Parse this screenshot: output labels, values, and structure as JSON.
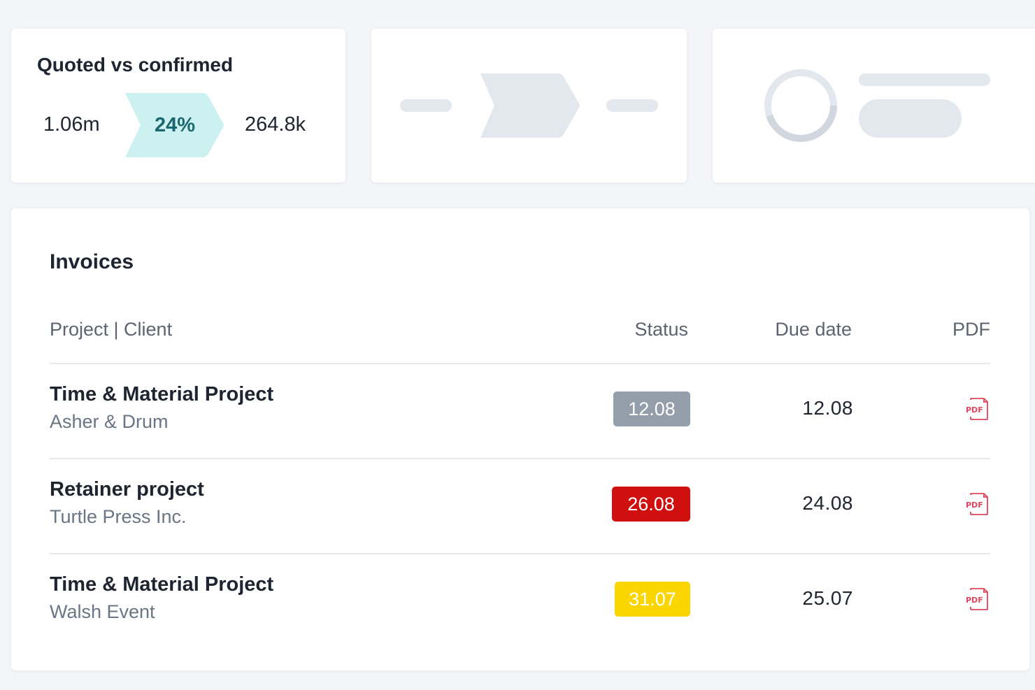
{
  "kpi_card": {
    "title": "Quoted vs confirmed",
    "quoted": "1.06m",
    "conversion": "24%",
    "confirmed": "264.8k",
    "accent_color": "#cdf0f0"
  },
  "invoices": {
    "title": "Invoices",
    "columns": {
      "project_client": "Project | Client",
      "status": "Status",
      "due_date": "Due date",
      "pdf": "PDF"
    },
    "rows": [
      {
        "project": "Time & Material Project",
        "client": "Asher & Drum",
        "status_date": "12.08",
        "status_color": "#949eab",
        "due_date": "12.08",
        "pdf_icon": "pdf-icon"
      },
      {
        "project": "Retainer project",
        "client": "Turtle Press Inc.",
        "status_date": "26.08",
        "status_color": "#d0100f",
        "due_date": "24.08",
        "pdf_icon": "pdf-icon"
      },
      {
        "project": "Time & Material Project",
        "client": "Walsh Event",
        "status_date": "31.07",
        "status_color": "#fad500",
        "due_date": "25.07",
        "pdf_icon": "pdf-icon"
      }
    ]
  }
}
